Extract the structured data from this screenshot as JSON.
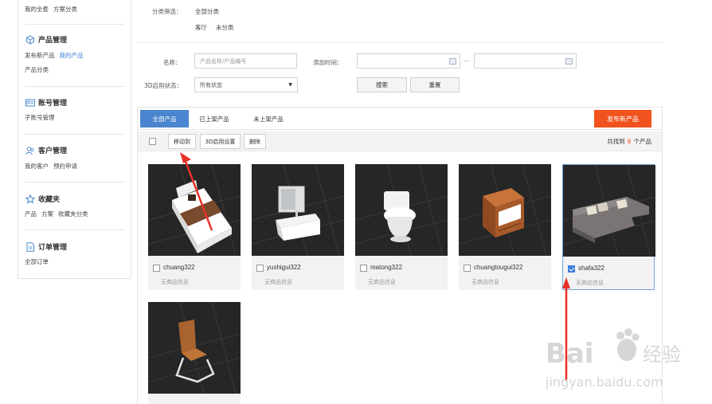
{
  "sidebar": {
    "top_links": [
      "我的全套",
      "方案分类"
    ],
    "sections": [
      {
        "title": "产品管理",
        "icon": "cube-icon",
        "links": [
          [
            "发布新产品",
            "我的产品"
          ],
          [
            "产品分类"
          ]
        ],
        "active": "我的产品"
      },
      {
        "title": "账号管理",
        "icon": "id-card-icon",
        "links": [
          [
            "子账号管理"
          ]
        ]
      },
      {
        "title": "客户管理",
        "icon": "users-icon",
        "links": [
          [
            "我的客户",
            "预约申请"
          ]
        ]
      },
      {
        "title": "收藏夹",
        "icon": "star-icon",
        "links": [
          [
            "产品",
            "方案",
            "收藏夹分类"
          ]
        ]
      },
      {
        "title": "订单管理",
        "icon": "document-icon",
        "links": [
          [
            "全部订单"
          ]
        ]
      }
    ]
  },
  "filter": {
    "category_label": "分类筛选：",
    "all_categories": "全部分类",
    "sub_categories": [
      "客厅",
      "未分类"
    ],
    "name_label": "名称：",
    "name_placeholder": "产品名称/产品编号",
    "date_label": "添加时间：",
    "date_separator": "—",
    "status_label": "3D启用状态：",
    "status_value": "所有状态",
    "search_button": "搜索",
    "reset_button": "重置"
  },
  "tabs": [
    "全部产品",
    "已上架产品",
    "未上架产品"
  ],
  "publish_button": "发布新产品",
  "toolbar": {
    "buttons": [
      "移动到",
      "3D启用设置",
      "删除"
    ],
    "count_prefix": "共找到",
    "count": "6",
    "count_suffix": "个产品"
  },
  "products": [
    {
      "name": "chuang322",
      "info": "无商品信息",
      "checked": false,
      "icon": "bed-icon"
    },
    {
      "name": "yushigui322",
      "info": "无商品信息",
      "checked": false,
      "icon": "bathroom-cabinet-icon"
    },
    {
      "name": "matong322",
      "info": "无商品信息",
      "checked": false,
      "icon": "toilet-icon"
    },
    {
      "name": "chuangtougui322",
      "info": "无商品信息",
      "checked": false,
      "icon": "nightstand-icon"
    },
    {
      "name": "shafa322",
      "info": "无商品信息",
      "checked": true,
      "icon": "sofa-icon"
    },
    {
      "name": "",
      "info": "",
      "checked": false,
      "icon": "chair-icon"
    }
  ],
  "watermark": {
    "brand": "Bai",
    "brand2": "经验",
    "url": "jingyan.baidu.com"
  },
  "colors": {
    "accent": "#4a86cf",
    "publish": "#f1521e",
    "arrow": "#e8312a",
    "link_active": "#3b7ddd"
  }
}
